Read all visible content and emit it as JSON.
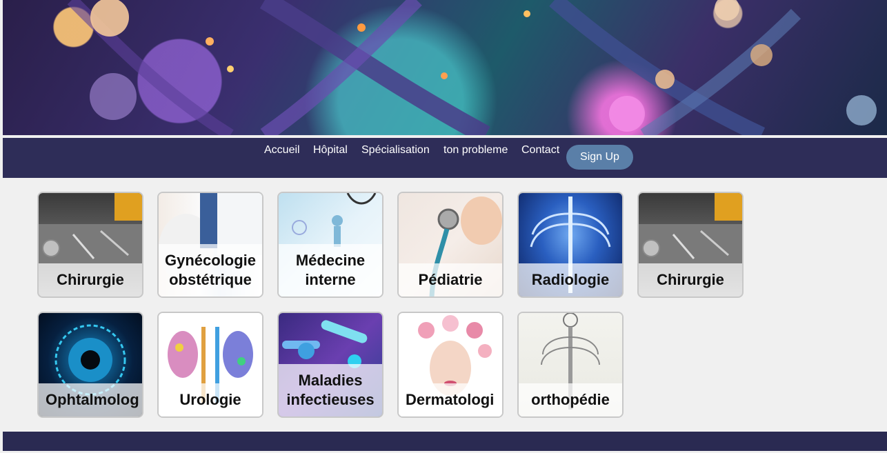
{
  "nav": {
    "items": [
      "Accueil",
      "Hôpital",
      "Spécialisation",
      "ton probleme",
      "Contact"
    ],
    "signup_label": "Sign Up"
  },
  "colors": {
    "nav_bg": "#2e2d58",
    "signup_bg": "#5a7fa8",
    "page_bg": "#f0f0f0",
    "footer_bg": "#2a2a52"
  },
  "specialties": [
    {
      "title": "Chirurgie",
      "image": "surgical-instruments"
    },
    {
      "title": "Gynécologie\nobstétrique",
      "image": "pregnant-woman-doctor"
    },
    {
      "title": "Médecine\ninterne",
      "image": "doctor-stethoscope-body"
    },
    {
      "title": "Pédiatrie",
      "image": "baby-stethoscope"
    },
    {
      "title": "Radiologie",
      "image": "chest-xray"
    },
    {
      "title": "Chirurgie",
      "image": "surgical-instruments"
    },
    {
      "title": "Ophtalmolog",
      "image": "digital-eye"
    },
    {
      "title": "Urologie",
      "image": "kidneys-illustration"
    },
    {
      "title": "Maladies\ninfectieuses",
      "image": "bacteria-virus"
    },
    {
      "title": "Dermatologi",
      "image": "flower-face"
    },
    {
      "title": "orthopédie",
      "image": "skeleton-sketch"
    }
  ]
}
